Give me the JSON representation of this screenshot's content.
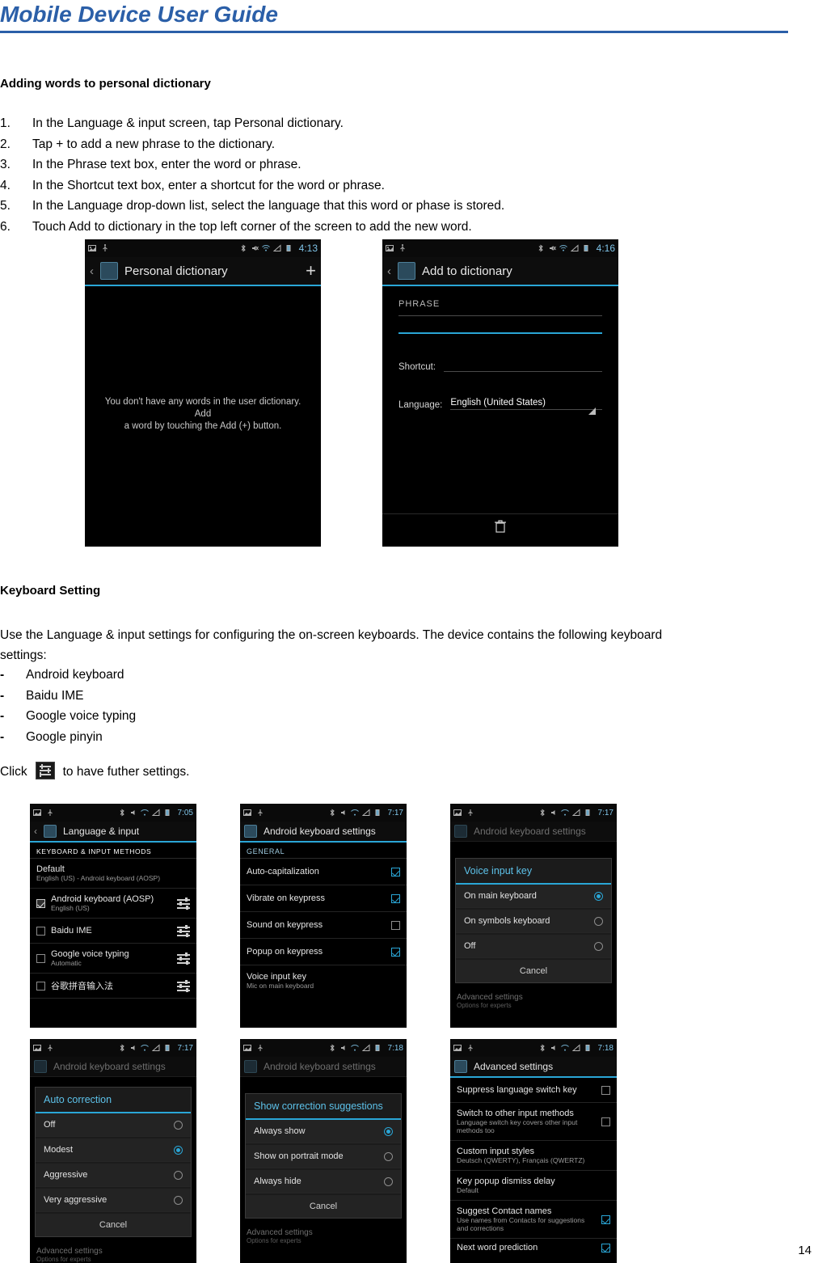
{
  "header": {
    "title": "Mobile Device User Guide"
  },
  "page_number": "14",
  "sections": {
    "dictionary_heading": "Adding words to personal dictionary",
    "dictionary_steps": [
      {
        "num": "1.",
        "text": "In the Language & input screen, tap Personal dictionary."
      },
      {
        "num": "2.",
        "text": "Tap + to add a new phrase to the dictionary."
      },
      {
        "num": "3.",
        "text": "In the Phrase text box, enter the word or phrase."
      },
      {
        "num": "4.",
        "text": "In the Shortcut text box, enter a shortcut for the word or phrase."
      },
      {
        "num": "5.",
        "text": "In the Language drop-down list, select the language that this word or phase is stored."
      },
      {
        "num": "6.",
        "text": "Touch Add to dictionary in the top left corner of the screen to add the new word."
      }
    ],
    "keyboard_heading": "Keyboard Setting",
    "keyboard_paragraph_line1": "Use the Language & input settings for configuring the on-screen keyboards. The device contains the following keyboard",
    "keyboard_paragraph_line2": "settings:",
    "keyboard_list": [
      {
        "dash": "-",
        "text": "Android keyboard"
      },
      {
        "dash": "-",
        "text": "Baidu IME"
      },
      {
        "dash": "-",
        "text": "Google voice typing"
      },
      {
        "dash": "-",
        "text": "Google pinyin"
      }
    ],
    "click_line_before": "Click",
    "click_line_after": "to have futher settings."
  },
  "screenshots": {
    "personal_dictionary": {
      "status_time": "4:13",
      "title": "Personal dictionary",
      "plus": "+",
      "empty_message_line1": "You don't have any words in the user dictionary. Add",
      "empty_message_line2": "a word by touching the Add (+) button."
    },
    "add_to_dictionary": {
      "status_time": "4:16",
      "title": "Add to dictionary",
      "phrase_label": "PHRASE",
      "shortcut_label": "Shortcut:",
      "language_label": "Language:",
      "language_value": "English (United States)",
      "trash_icon": "trash-icon"
    },
    "language_input": {
      "status_time": "7:05",
      "title": "Language & input",
      "section_label": "KEYBOARD & INPUT METHODS",
      "rows": [
        {
          "title": "Default",
          "subtitle": "English (US) - Android keyboard (AOSP)",
          "check": "none",
          "slider": false
        },
        {
          "title": "Android keyboard (AOSP)",
          "subtitle": "English (US)",
          "check": "checked",
          "slider": true
        },
        {
          "title": "Baidu IME",
          "subtitle": "",
          "check": "unchecked",
          "slider": true
        },
        {
          "title": "Google voice typing",
          "subtitle": "Automatic",
          "check": "unchecked",
          "slider": true
        },
        {
          "title": "谷歌拼音输入法",
          "subtitle": "",
          "check": "unchecked",
          "slider": true
        }
      ]
    },
    "android_keyboard_settings": {
      "status_time": "7:17",
      "title": "Android keyboard settings",
      "section_label": "GENERAL",
      "rows": [
        {
          "title": "Auto-capitalization",
          "subtitle": "",
          "check": "checked"
        },
        {
          "title": "Vibrate on keypress",
          "subtitle": "",
          "check": "checked"
        },
        {
          "title": "Sound on keypress",
          "subtitle": "",
          "check": "unchecked"
        },
        {
          "title": "Popup on keypress",
          "subtitle": "",
          "check": "checked"
        },
        {
          "title": "Voice input key",
          "subtitle": "Mic on main keyboard",
          "check": "none"
        }
      ]
    },
    "voice_input_key_dialog": {
      "status_time": "7:17",
      "title": "Android keyboard settings",
      "dialog_title": "Voice input key",
      "options": [
        {
          "label": "On main keyboard",
          "selected": true
        },
        {
          "label": "On symbols keyboard",
          "selected": false
        },
        {
          "label": "Off",
          "selected": false
        }
      ],
      "cancel": "Cancel",
      "footer_title": "Advanced settings",
      "footer_subtitle": "Options for experts"
    },
    "auto_correction_dialog": {
      "status_time": "7:17",
      "title": "Android keyboard settings",
      "dialog_title": "Auto correction",
      "options": [
        {
          "label": "Off",
          "selected": false
        },
        {
          "label": "Modest",
          "selected": true
        },
        {
          "label": "Aggressive",
          "selected": false
        },
        {
          "label": "Very aggressive",
          "selected": false
        }
      ],
      "cancel": "Cancel",
      "footer_title": "Advanced settings",
      "footer_subtitle": "Options for experts"
    },
    "show_correction_dialog": {
      "status_time": "7:18",
      "title": "Android keyboard settings",
      "dialog_title": "Show correction suggestions",
      "options": [
        {
          "label": "Always show",
          "selected": true
        },
        {
          "label": "Show on portrait mode",
          "selected": false
        },
        {
          "label": "Always hide",
          "selected": false
        }
      ],
      "cancel": "Cancel",
      "footer_title": "Advanced settings",
      "footer_subtitle": "Options for experts"
    },
    "advanced_settings": {
      "status_time": "7:18",
      "title": "Advanced settings",
      "rows": [
        {
          "title": "Suppress language switch key",
          "subtitle": "",
          "check": "unchecked"
        },
        {
          "title": "Switch to other input methods",
          "subtitle": "Language switch key covers other input methods too",
          "check": "unchecked"
        },
        {
          "title": "Custom input styles",
          "subtitle": "Deutsch (QWERTY), Français (QWERTZ)",
          "check": "none"
        },
        {
          "title": "Key popup dismiss delay",
          "subtitle": "Default",
          "check": "none"
        },
        {
          "title": "Suggest Contact names",
          "subtitle": "Use names from Contacts for suggestions and corrections",
          "check": "checked"
        },
        {
          "title": "Next word prediction",
          "subtitle": "",
          "check": "checked"
        }
      ]
    }
  }
}
